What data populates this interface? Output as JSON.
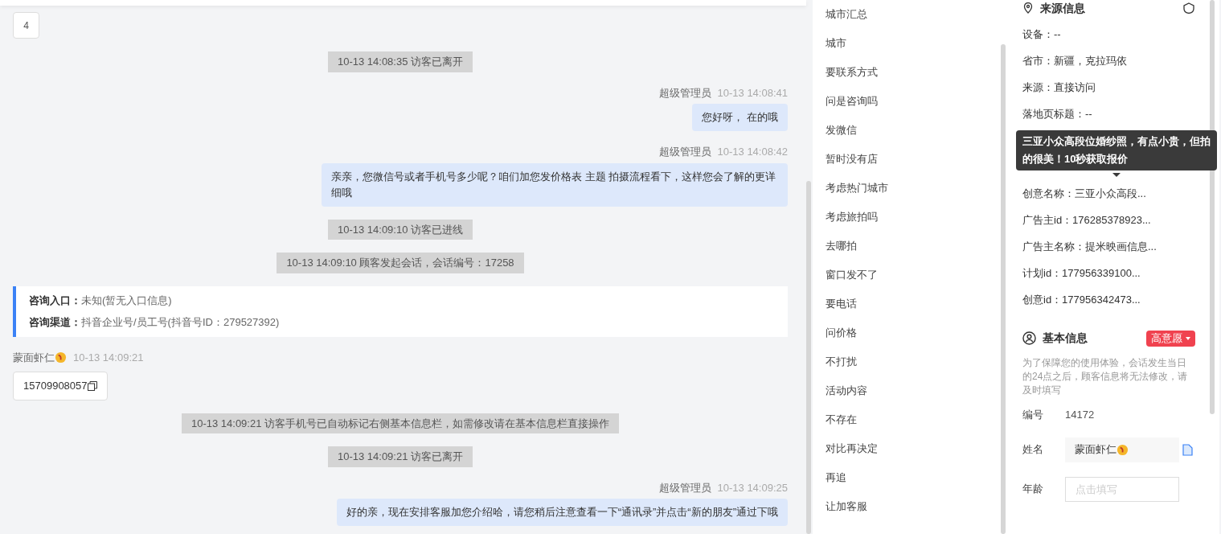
{
  "chat": {
    "page_number": "4",
    "messages": [
      {
        "kind": "system",
        "text": "10-13 14:08:35 访客已离开"
      },
      {
        "kind": "agent",
        "sender": "超级管理员",
        "time": "10-13 14:08:41",
        "text": "您好呀，  在的哦"
      },
      {
        "kind": "agent",
        "sender": "超级管理员",
        "time": "10-13 14:08:42",
        "text": "亲亲，您微信号或者手机号多少呢？咱们加您发价格表 主题 拍摄流程看下，这样您会了解的更详细哦"
      },
      {
        "kind": "system",
        "text": "10-13 14:09:10 访客已进线"
      },
      {
        "kind": "system",
        "text": "10-13 14:09:10 顾客发起会话，会话编号：17258"
      },
      {
        "kind": "info",
        "lines": [
          {
            "label": "咨询入口：",
            "value": "未知(暂无入口信息)"
          },
          {
            "label": "咨询渠道：",
            "value": "抖音企业号/员工号(抖音号ID：279527392)"
          }
        ]
      },
      {
        "kind": "visitor",
        "sender": "蒙面虾仁",
        "time": "10-13 14:09:21",
        "text": "15709908057"
      },
      {
        "kind": "system",
        "text": "10-13 14:09:21 访客手机号已自动标记右侧基本信息栏，如需修改请在基本信息栏直接操作"
      },
      {
        "kind": "system",
        "text": "10-13 14:09:21 访客已离开"
      },
      {
        "kind": "agent",
        "sender": "超级管理员",
        "time": "10-13 14:09:25",
        "text": "好的亲，现在安排客服加您介绍哈，请您稍后注意查看一下“通讯录”并点击“新的朋友”通过下哦"
      }
    ]
  },
  "quick_replies": [
    "城市汇总",
    "城市",
    "要联系方式",
    "问是咨询吗",
    "发微信",
    "暂时没有店",
    "考虑热门城市",
    "考虑旅拍吗",
    "去哪拍",
    "窗口发不了",
    "要电话",
    "问价格",
    "不打扰",
    "活动内容",
    "不存在",
    "对比再决定",
    "再追",
    "让加客服"
  ],
  "source_info": {
    "title": "来源信息",
    "rows": [
      "设备：--",
      "省市：新疆，克拉玛依",
      "来源：直接访问",
      "落地页标题：--",
      "创意名称：三亚小众高段...",
      "广告主id：176285378923...",
      "广告主名称：提米映画信息...",
      "计划id：177956339100...",
      "创意id：177956342473..."
    ],
    "tooltip": "三亚小众高段位婚纱照，有点小贵，但拍的很美！10秒获取报价"
  },
  "basic_info": {
    "title": "基本信息",
    "intent_tag": "高意愿",
    "notice": "为了保障您的使用体验，会话发生当日的24点之后，顾客信息将无法修改，请及时填写",
    "fields": [
      {
        "kind": "text",
        "label": "编号",
        "value": "14172"
      },
      {
        "kind": "filled",
        "label": "姓名",
        "value": "蒙面虾仁"
      },
      {
        "kind": "input",
        "label": "年龄",
        "placeholder": "点击填写"
      }
    ]
  }
}
